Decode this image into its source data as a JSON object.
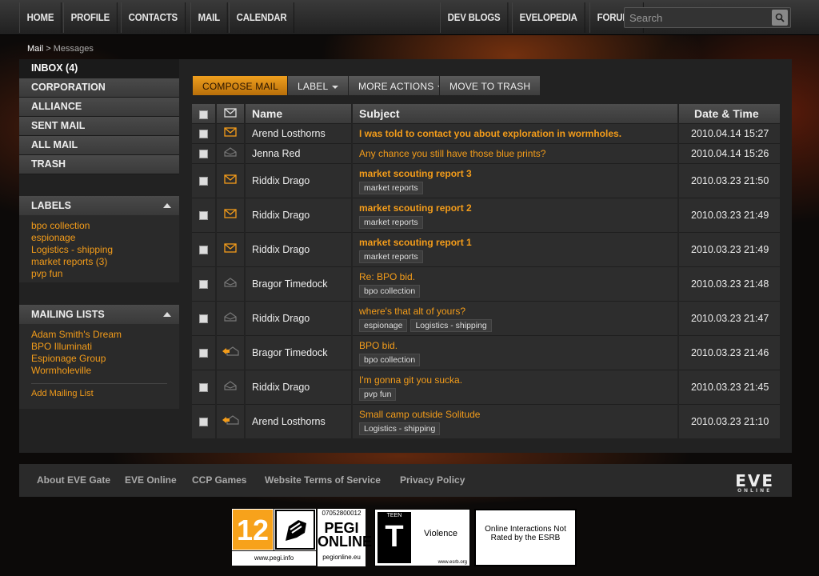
{
  "nav": {
    "left": [
      "HOME",
      "PROFILE",
      "CONTACTS",
      "MAIL",
      "CALENDAR"
    ],
    "right": [
      "DEV BLOGS",
      "EVELOPEDIA",
      "FORUMS"
    ],
    "search_placeholder": "Search"
  },
  "breadcrumb": {
    "root": "Mail",
    "sep": ">",
    "current": "Messages"
  },
  "folders": [
    "INBOX (4)",
    "CORPORATION",
    "ALLIANCE",
    "SENT MAIL",
    "ALL MAIL",
    "TRASH"
  ],
  "labels": {
    "title": "LABELS",
    "items": [
      "bpo collection",
      "espionage",
      "Logistics - shipping",
      "market reports (3)",
      "pvp fun"
    ]
  },
  "mailing_lists": {
    "title": "MAILING LISTS",
    "items": [
      "Adam Smith's Dream",
      "BPO Illuminati",
      "Espionage Group",
      "Wormholeville"
    ],
    "add": "Add Mailing List"
  },
  "toolbar": {
    "compose": "COMPOSE MAIL",
    "label": "LABEL",
    "more": "MORE ACTIONS",
    "trash": "MOVE TO TRASH"
  },
  "columns": {
    "name": "Name",
    "subject": "Subject",
    "date": "Date & Time"
  },
  "messages": [
    {
      "name": "Arend Losthorns",
      "subject": "I was told to contact you about exploration in wormholes.",
      "tags": [],
      "date": "2010.04.14 15:27",
      "status": "unread"
    },
    {
      "name": "Jenna Red",
      "subject": "Any chance you still have those blue prints?",
      "tags": [],
      "date": "2010.04.14 15:26",
      "status": "read"
    },
    {
      "name": "Riddix Drago",
      "subject": "market scouting report 3",
      "tags": [
        "market reports"
      ],
      "date": "2010.03.23 21:50",
      "status": "unread"
    },
    {
      "name": "Riddix Drago",
      "subject": "market scouting report 2",
      "tags": [
        "market reports"
      ],
      "date": "2010.03.23 21:49",
      "status": "unread"
    },
    {
      "name": "Riddix Drago",
      "subject": "market scouting report 1",
      "tags": [
        "market reports"
      ],
      "date": "2010.03.23 21:49",
      "status": "unread"
    },
    {
      "name": "Bragor Timedock",
      "subject": "Re: BPO bid.",
      "tags": [
        "bpo collection"
      ],
      "date": "2010.03.23 21:48",
      "status": "read"
    },
    {
      "name": "Riddix Drago",
      "subject": "where's that alt of yours?",
      "tags": [
        "espionage",
        "Logistics - shipping"
      ],
      "date": "2010.03.23 21:47",
      "status": "read"
    },
    {
      "name": "Bragor Timedock",
      "subject": "BPO bid.",
      "tags": [
        "bpo collection"
      ],
      "date": "2010.03.23 21:46",
      "status": "replied"
    },
    {
      "name": "Riddix Drago",
      "subject": "I'm gonna git you sucka.",
      "tags": [
        "pvp fun"
      ],
      "date": "2010.03.23 21:45",
      "status": "read"
    },
    {
      "name": "Arend Losthorns",
      "subject": "Small camp outside Solitude",
      "tags": [
        "Logistics - shipping"
      ],
      "date": "2010.03.23 21:10",
      "status": "replied"
    }
  ],
  "footer": {
    "links": [
      "About EVE Gate",
      "EVE Online",
      "CCP Games",
      "Website Terms of Service",
      "Privacy Policy"
    ],
    "logo": "EVE",
    "logo_sub": "ONLINE"
  },
  "ratings": {
    "pegi_age": "12",
    "pegi_url": "www.pegi.info",
    "pegi_online_code": "07052800012",
    "pegi_online_line1": "PEGI",
    "pegi_online_line2": "ONLINE",
    "pegi_online_url": "pegionline.eu",
    "esrb_teen": "TEEN",
    "esrb_letter": "T",
    "esrb_desc": "Violence",
    "esrb_url": "www.esrb.org",
    "esrb_online": "Online Interactions Not Rated by the ESRB"
  },
  "colors": {
    "accent": "#f39c1a",
    "panel": "#222222",
    "row": "#2d2d2d"
  }
}
